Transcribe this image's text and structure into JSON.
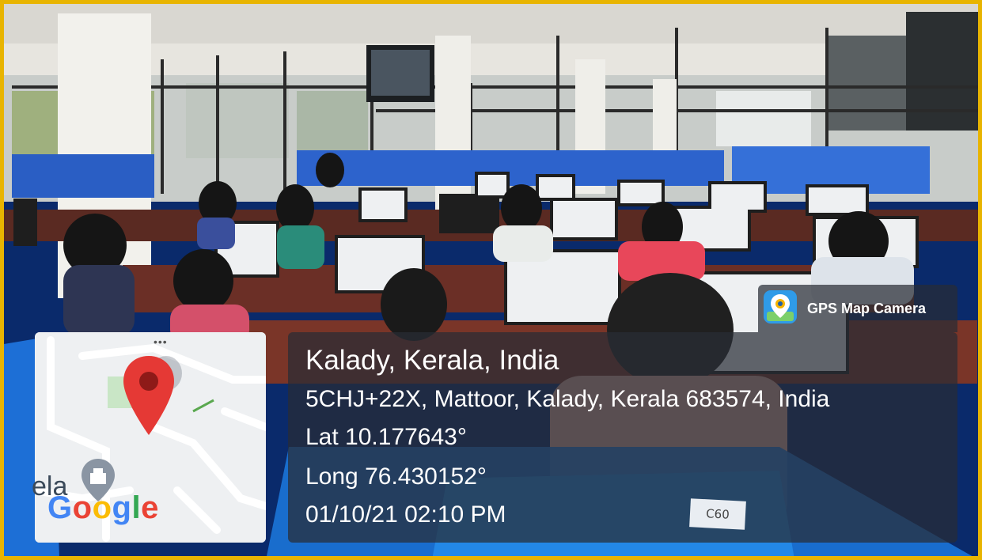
{
  "overlay": {
    "app_badge": "GPS Map Camera",
    "location_title": "Kalady, Kerala, India",
    "address": "5CHJ+22X, Mattoor, Kalady, Kerala 683574, India",
    "latitude": "Lat 10.177643°",
    "longitude": "Long 76.430152°",
    "timestamp": "01/10/21 02:10 PM"
  },
  "map_thumbnail": {
    "place_fragment": "ela",
    "google_logo": [
      "G",
      "o",
      "o",
      "g",
      "l",
      "e"
    ],
    "menu_dots": "•••",
    "pin_color": "#e53935"
  },
  "scene": {
    "desk_tag": "C60"
  },
  "colors": {
    "frame_border": "#e8b400",
    "panel_bg": "rgba(40,44,52,0.72)"
  },
  "icons": [
    "map-pin-icon",
    "gps-camera-icon",
    "landmark-icon"
  ]
}
